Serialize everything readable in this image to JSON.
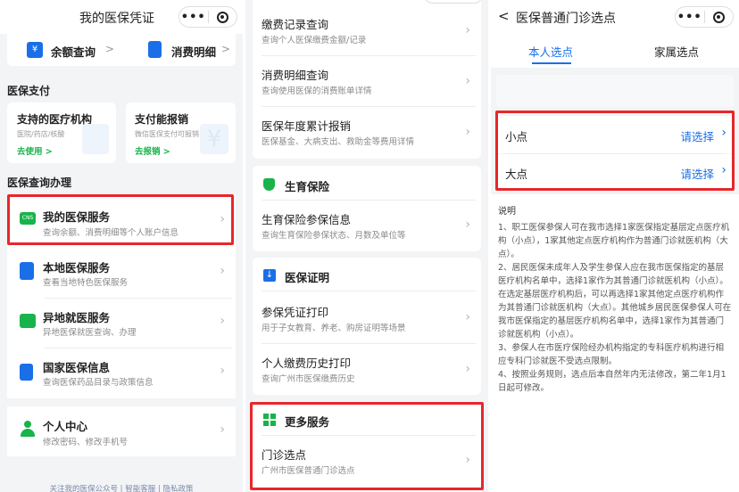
{
  "panel1": {
    "title": "我的医保凭证",
    "quick": [
      {
        "label": "余额查询",
        "arrow": ">",
        "icon": "balance-icon"
      },
      {
        "label": "消费明细",
        "arrow": ">",
        "icon": "bill-icon"
      }
    ],
    "section_pay": "医保支付",
    "pay_cards": [
      {
        "title": "支持的医疗机构",
        "sub": "医院/药店/核酸",
        "link": "去使用 >"
      },
      {
        "title": "支付能报销",
        "sub": "微信医保支付可报销",
        "link": "去报销 >"
      }
    ],
    "section_query": "医保查询办理",
    "services": [
      {
        "title": "我的医保服务",
        "sub": "查询余额、消费明细等个人账户信息",
        "icon": "card-icon"
      },
      {
        "title": "本地医保服务",
        "sub": "查看当地特色医保服务",
        "icon": "building-icon"
      },
      {
        "title": "异地就医服务",
        "sub": "异地医保就医查询、办理",
        "icon": "transfer-icon"
      },
      {
        "title": "国家医保信息",
        "sub": "查询医保药品目录与政策信息",
        "icon": "document-icon"
      }
    ],
    "personal": {
      "title": "个人中心",
      "sub": "修改密码、修改手机号"
    },
    "footer": "关注我的医保公众号 | 智能客服 | 隐私政策"
  },
  "panel2": {
    "records": [
      {
        "title": "缴费记录查询",
        "sub": "查询个人医保缴费金额/记录"
      },
      {
        "title": "消费明细查询",
        "sub": "查询使用医保的消费账单详情"
      },
      {
        "title": "医保年度累计报销",
        "sub": "医保基金、大病支出、救助金等费用详情"
      }
    ],
    "maternity_header": "生育保险",
    "maternity": {
      "title": "生育保险参保信息",
      "sub": "查询生育保险参保状态、月数及单位等"
    },
    "proof_header": "医保证明",
    "proofs": [
      {
        "title": "参保凭证打印",
        "sub": "用于子女教育、养老、购房证明等场景"
      },
      {
        "title": "个人缴费历史打印",
        "sub": "查询广州市医保缴费历史"
      }
    ],
    "more_header": "更多服务",
    "more": {
      "title": "门诊选点",
      "sub": "广州市医保普通门诊选点"
    }
  },
  "panel3": {
    "back": "<",
    "title": "医保普通门诊选点",
    "tabs": [
      "本人选点",
      "家属选点"
    ],
    "options": [
      {
        "label": "小点",
        "value": "请选择"
      },
      {
        "label": "大点",
        "value": "请选择"
      }
    ],
    "note_title": "说明",
    "notes": [
      "1、职工医保参保人可在我市选择1家医保指定基层定点医疗机构（小点），1家其他定点医疗机构作为普通门诊就医机构（大点）。",
      "2、居民医保未成年人及学生参保人应在我市医保指定的基层医疗机构名单中，选择1家作为其普通门诊就医机构（小点）。在选定基层医疗机构后，可以再选择1家其他定点医疗机构作为其普通门诊就医机构（大点）。其他城乡居民医保参保人可在我市医保指定的基层医疗机构名单中，选择1家作为其普通门诊就医机构（小点）。",
      "3、参保人在市医疗保险经办机构指定的专科医疗机构进行相应专科门诊就医不受选点限制。",
      "4、按照业务规则，选点后本自然年内无法修改，第二年1月1日起可修改。"
    ]
  },
  "colors": {
    "accent": "#1a6fe8",
    "highlight": "#e8262b",
    "green": "#18b34a"
  }
}
